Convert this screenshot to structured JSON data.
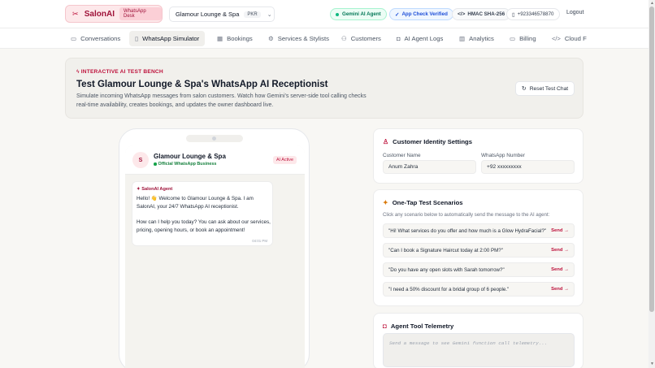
{
  "brand": {
    "name": "SalonAI",
    "pill": "WhatsApp Desk"
  },
  "salon_select": {
    "value": "Glamour Lounge & Spa",
    "currency": "PKR"
  },
  "badges": {
    "gemini": "Gemini AI Agent",
    "app_check": "App Check Verified",
    "hmac": "HMAC SHA-256",
    "phone": "+923346578870"
  },
  "logout": "Logout",
  "nav": {
    "tabs": [
      {
        "label": "Conversations"
      },
      {
        "label": "WhatsApp Simulator"
      },
      {
        "label": "Bookings"
      },
      {
        "label": "Services & Stylists"
      },
      {
        "label": "Customers"
      },
      {
        "label": "AI Agent Logs"
      },
      {
        "label": "Analytics"
      },
      {
        "label": "Billing"
      },
      {
        "label": "Cloud F"
      }
    ]
  },
  "hero": {
    "eyebrow": "INTERACTIVE AI TEST BENCH",
    "title": "Test Glamour Lounge & Spa's WhatsApp AI Receptionist",
    "description": "Simulate incoming WhatsApp messages from salon customers. Watch how Gemini's server-side tool calling checks real-time availability, creates bookings, and updates the owner dashboard live.",
    "reset_label": "Reset Test Chat"
  },
  "chat": {
    "avatar": "S",
    "name": "Glamour Lounge & Spa",
    "subtitle": "Official WhatsApp Business",
    "status": "AI Active",
    "messages": [
      {
        "sender": "SalonAI Agent",
        "text": "Hello! 👋 Welcome to Glamour Lounge & Spa. I am SalonAI, your 24/7 WhatsApp AI receptionist.\n\nHow can I help you today? You can ask about our services, pricing, opening hours, or book an appointment!",
        "time": "04:01 PM"
      }
    ]
  },
  "identity": {
    "title": "Customer Identity Settings",
    "name_label": "Customer Name",
    "name_value": "Anum Zahra",
    "phone_label": "WhatsApp Number",
    "phone_value": "+92 xxxxxxxxx"
  },
  "scenarios": {
    "title": "One-Tap Test Scenarios",
    "hint": "Click any scenario below to automatically send the message to the AI agent:",
    "send_label": "Send →",
    "items": [
      {
        "text": "\"Hi! What services do you offer and how much is a Glow HydraFacial?\""
      },
      {
        "text": "\"Can I book a Signature Haircut today at 2:00 PM?\""
      },
      {
        "text": "\"Do you have any open slots with Sarah tomorrow?\""
      },
      {
        "text": "\"I need a 50% discount for a bridal group of 6 people.\""
      }
    ]
  },
  "telemetry": {
    "title": "Agent Tool Telemetry",
    "placeholder": "Send a message to see Gemini function call telemetry..."
  },
  "colors": {
    "accent": "#be123c",
    "brand_bg": "#fde8ea",
    "page_bg": "#f8f7f4",
    "success": "#047857"
  },
  "icons": {
    "brand": "scissors-icon",
    "chevron": "chevron-down-icon",
    "status_dot": "status-dot-icon",
    "app_check": "check-circle-icon",
    "hmac": "code-icon",
    "phone": "phone-icon",
    "reset": "refresh-icon",
    "identity": "user-icon",
    "scenarios": "sparkle-icon",
    "telemetry": "bot-icon"
  }
}
